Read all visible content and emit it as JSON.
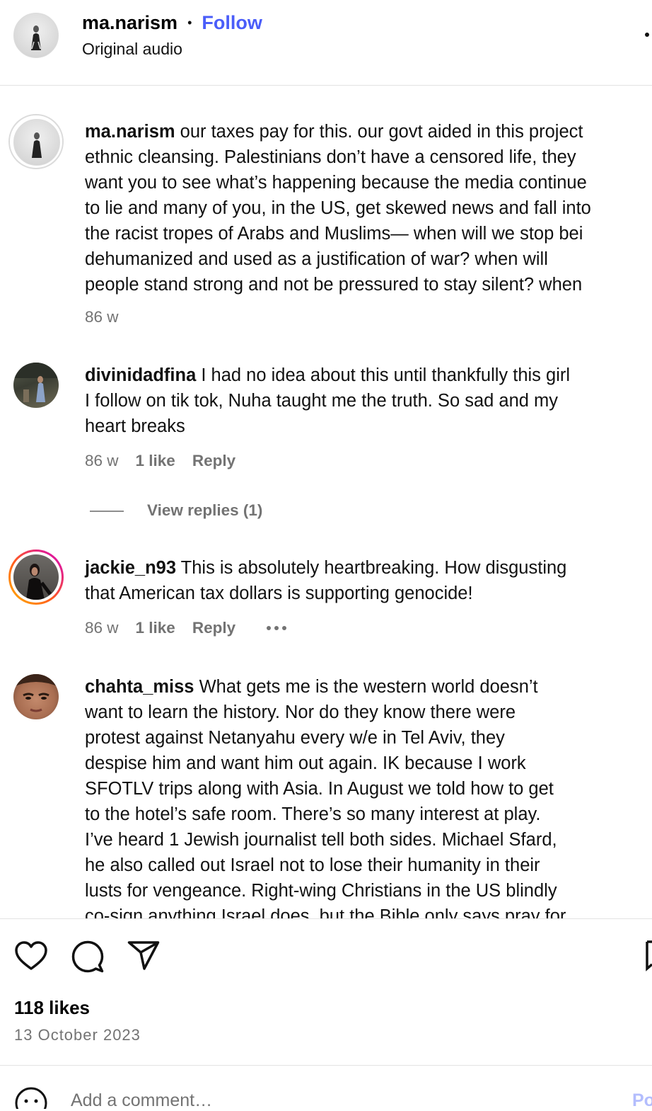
{
  "header": {
    "username": "ma.narism",
    "separator": "•",
    "follow_label": "Follow",
    "subtitle": "Original audio",
    "more_icon": "more-dots-icon"
  },
  "comments": [
    {
      "username": "ma.narism",
      "lines": [
        "our taxes pay for this. our govt aided in this project",
        "ethnic cleansing. Palestinians don’t have a censored life, they",
        "want you to see what’s happening because the media continue",
        "to lie and many of you, in the US, get skewed news and fall into",
        "the racist tropes of Arabs and Muslims— when will we stop bei",
        "dehumanized and used as a justification of war? when will",
        "people stand strong and not be pressured to stay silent? when"
      ],
      "time": "86 w"
    },
    {
      "username": "divinidadfina",
      "lines": [
        "I had no idea about this until thankfully this girl",
        "I follow on tik tok, Nuha taught me the truth. So sad and my",
        "heart breaks"
      ],
      "time": "86 w",
      "likes": "1 like",
      "reply": "Reply",
      "view_replies": "View replies (1)"
    },
    {
      "username": "jackie_n93",
      "lines": [
        "This is absolutely heartbreaking. How disgusting",
        "that American tax dollars is supporting genocide!"
      ],
      "time": "86 w",
      "likes": "1 like",
      "reply": "Reply"
    },
    {
      "username": "chahta_miss",
      "lines": [
        "What gets me is the western world doesn’t",
        "want to learn the history. Nor do they know there were",
        "protest against Netanyahu every w/e in Tel Aviv, they",
        "despise him and want him out again. IK because I work",
        "SFOTLV trips along with Asia. In August we told how to get",
        "to the hotel’s safe room. There’s so many interest at play.",
        "I’ve heard 1 Jewish journalist tell both sides. Michael Sfard,",
        "he also called out Israel not to lose their humanity in their",
        "lusts for vengeance. Right-wing Christians in the US blindly",
        "co-sign anything Israel does, but the Bible only says pray for"
      ]
    }
  ],
  "actions": {
    "like_icon": "heart-icon",
    "comment_icon": "comment-bubble-icon",
    "share_icon": "paper-plane-icon",
    "save_icon": "bookmark-icon"
  },
  "stats": {
    "likes": "118 likes",
    "date": "13 October 2023"
  },
  "comment_box": {
    "placeholder": "Add a comment…",
    "post_label": "Po",
    "emoji_icon": "emoji-icon"
  },
  "colors": {
    "accent": "#4a5df9",
    "muted": "#737373",
    "story_ring_start": "#d300c5",
    "story_ring_end": "#ff7a00"
  }
}
